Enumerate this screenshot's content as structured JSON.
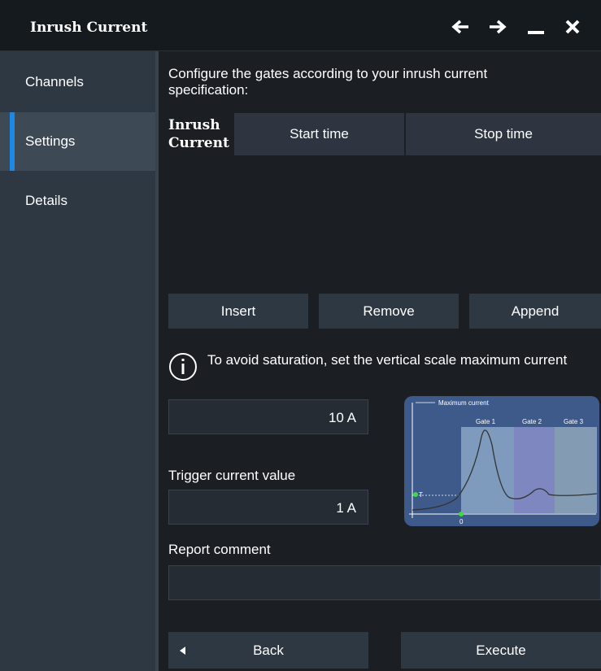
{
  "window": {
    "title": "Inrush Current",
    "back_icon": "arrow-left-icon",
    "forward_icon": "arrow-right-icon",
    "minimize_icon": "minimize-icon",
    "close_icon": "close-icon"
  },
  "sidebar": {
    "items": [
      {
        "label": "Channels",
        "active": false
      },
      {
        "label": "Settings",
        "active": true
      },
      {
        "label": "Details",
        "active": false
      }
    ]
  },
  "main": {
    "instruction": "Configure the gates according to your inrush current specification:",
    "table": {
      "col_name": "Inrush Current",
      "col_start": "Start time",
      "col_stop": "Stop time",
      "rows": []
    },
    "buttons": {
      "insert": "Insert",
      "remove": "Remove",
      "append": "Append"
    },
    "info_text": "To avoid saturation, set the vertical scale maximum current",
    "max_current_value": "10 A",
    "trigger_label": "Trigger current value",
    "trigger_value": "1 A",
    "report_label": "Report comment",
    "report_value": "",
    "diagram": {
      "max_label": "Maximum current",
      "gate1": "Gate 1",
      "gate2": "Gate 2",
      "gate3": "Gate 3",
      "trigger_mark": "T",
      "zero": "0"
    },
    "back_label": "Back",
    "execute_label": "Execute"
  },
  "colors": {
    "accent": "#1e88e5",
    "sidebar": "#2e3843",
    "background": "#1b1f24"
  }
}
